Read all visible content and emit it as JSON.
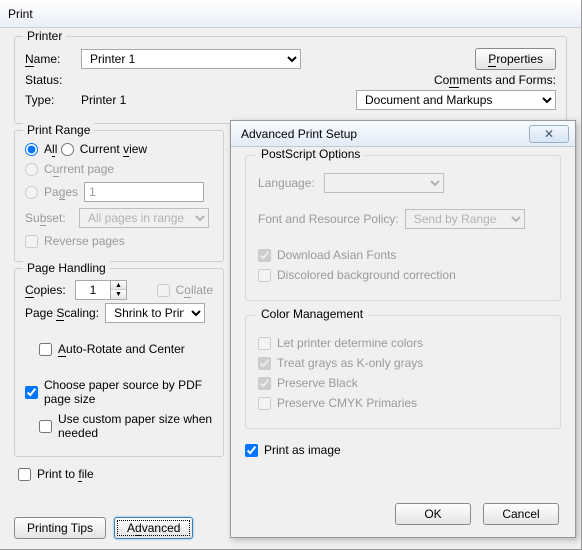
{
  "print": {
    "title": "Print",
    "printer_group": "Printer",
    "name_label": "Name:",
    "name_value": "Printer 1",
    "properties_btn": "Properties",
    "status_label": "Status:",
    "type_label": "Type:",
    "type_value": "Printer 1",
    "comments_label": "Comments and Forms:",
    "comments_value": "Document and Markups",
    "range_group": "Print Range",
    "radio_all": "All",
    "radio_currentview": "Current view",
    "radio_currentpage": "Current page",
    "radio_pages": "Pages",
    "pages_value": "1",
    "subset_label": "Subset:",
    "subset_value": "All pages in range",
    "reverse_pages": "Reverse pages",
    "handling_group": "Page Handling",
    "copies_label": "Copies:",
    "copies_value": "1",
    "collate_label": "Collate",
    "scaling_label": "Page Scaling:",
    "scaling_value": "Shrink to Printable Area",
    "autorotate": "Auto-Rotate and Center",
    "papersource": "Choose paper source by PDF page size",
    "custompaper": "Use custom paper size when needed",
    "print_to_file": "Print to file",
    "printing_tips_btn": "Printing Tips",
    "advanced_btn": "Advanced"
  },
  "adv": {
    "title": "Advanced Print Setup",
    "ps_group": "PostScript Options",
    "language_label": "Language:",
    "policy_label": "Font and Resource Policy:",
    "policy_value": "Send by Range",
    "download_asian": "Download Asian Fonts",
    "discolored_bg": "Discolored background correction",
    "color_group": "Color Management",
    "let_printer": "Let printer determine colors",
    "treat_grays": "Treat grays as K-only grays",
    "preserve_black": "Preserve Black",
    "preserve_cmyk": "Preserve CMYK Primaries",
    "print_as_image": "Print as image",
    "ok_btn": "OK",
    "cancel_btn": "Cancel"
  }
}
